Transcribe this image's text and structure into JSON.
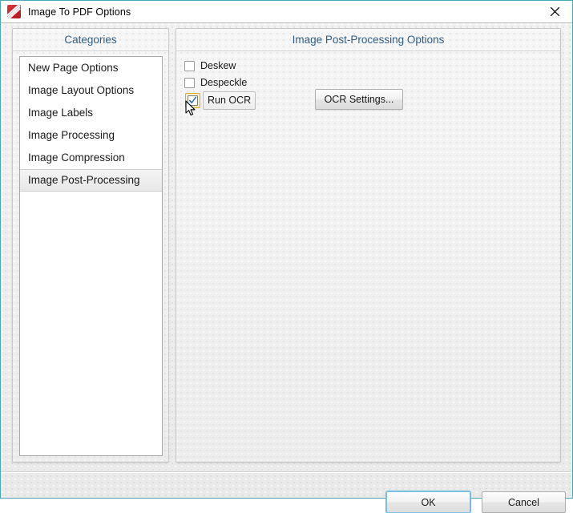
{
  "window": {
    "title": "Image To PDF Options",
    "icon": "pdf-document-icon",
    "close_label": "✕"
  },
  "categories_panel": {
    "header": "Categories",
    "items": [
      {
        "label": "New Page Options",
        "selected": false
      },
      {
        "label": "Image Layout Options",
        "selected": false
      },
      {
        "label": "Image Labels",
        "selected": false
      },
      {
        "label": "Image Processing",
        "selected": false
      },
      {
        "label": "Image Compression",
        "selected": false
      },
      {
        "label": "Image Post-Processing",
        "selected": true
      }
    ]
  },
  "options_panel": {
    "header": "Image Post-Processing Options",
    "checkboxes": [
      {
        "label": "Deskew",
        "checked": false
      },
      {
        "label": "Despeckle",
        "checked": false
      },
      {
        "label": "Run OCR",
        "checked": true,
        "focused": true
      }
    ],
    "ocr_settings_button": "OCR Settings..."
  },
  "footer": {
    "ok_label": "OK",
    "cancel_label": "Cancel"
  },
  "colors": {
    "dialog_border": "#49a7b8",
    "header_text": "#2f5d86",
    "focus_ring": "#6fb9dd",
    "checkbox_focus_border": "#e0a526",
    "checkbox_focus_fill": "#fbe9b4",
    "checkmark": "#2b6fb5",
    "app_icon_red": "#c1272d"
  }
}
